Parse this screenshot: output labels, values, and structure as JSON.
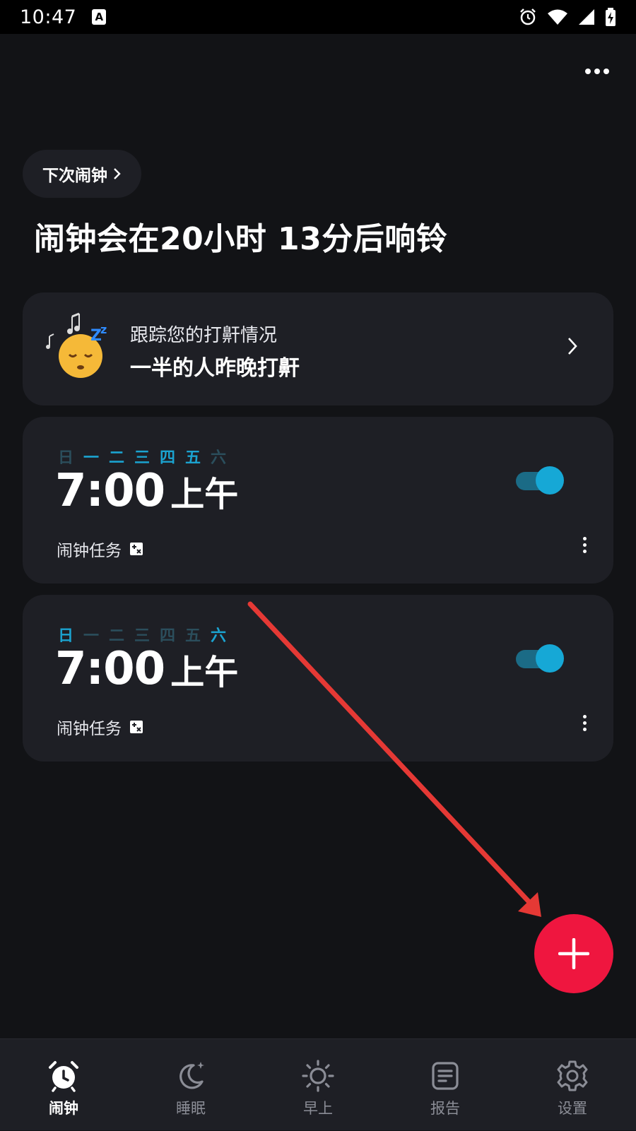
{
  "status_bar": {
    "time": "10:47",
    "notification_icon": "A",
    "icons": [
      "alarm-icon",
      "wifi-icon",
      "signal-icon",
      "battery-charging-icon"
    ]
  },
  "header": {
    "more_icon": "more-horizontal-icon",
    "next_alarm_label": "下次闹钟",
    "headline": "闹钟会在20小时 13分后响铃"
  },
  "snore_card": {
    "title": "跟踪您的打鼾情况",
    "subtitle": "一半的人昨晚打鼾"
  },
  "alarms": [
    {
      "days": [
        {
          "label": "日",
          "on": false
        },
        {
          "label": "一",
          "on": true
        },
        {
          "label": "二",
          "on": true
        },
        {
          "label": "三",
          "on": true
        },
        {
          "label": "四",
          "on": true
        },
        {
          "label": "五",
          "on": true
        },
        {
          "label": "六",
          "on": false
        }
      ],
      "time": "7:00",
      "ampm": "上午",
      "mission_label": "闹钟任务",
      "enabled": true
    },
    {
      "days": [
        {
          "label": "日",
          "on": true
        },
        {
          "label": "一",
          "on": false
        },
        {
          "label": "二",
          "on": false
        },
        {
          "label": "三",
          "on": false
        },
        {
          "label": "四",
          "on": false
        },
        {
          "label": "五",
          "on": false
        },
        {
          "label": "六",
          "on": true
        }
      ],
      "time": "7:00",
      "ampm": "上午",
      "mission_label": "闹钟任务",
      "enabled": true
    }
  ],
  "fab": {
    "icon": "plus-icon"
  },
  "bottom_nav": [
    {
      "label": "闹钟",
      "icon": "alarm-clock-icon",
      "active": true
    },
    {
      "label": "睡眠",
      "icon": "moon-icon",
      "active": false
    },
    {
      "label": "早上",
      "icon": "sun-icon",
      "active": false
    },
    {
      "label": "报告",
      "icon": "report-icon",
      "active": false
    },
    {
      "label": "设置",
      "icon": "gear-icon",
      "active": false
    }
  ],
  "colors": {
    "background": "#121316",
    "card": "#1e1f25",
    "accent_blue": "#16a8d6",
    "day_off": "#2b4e5c",
    "fab_red": "#ef163f",
    "annotation_arrow": "#e53935"
  }
}
